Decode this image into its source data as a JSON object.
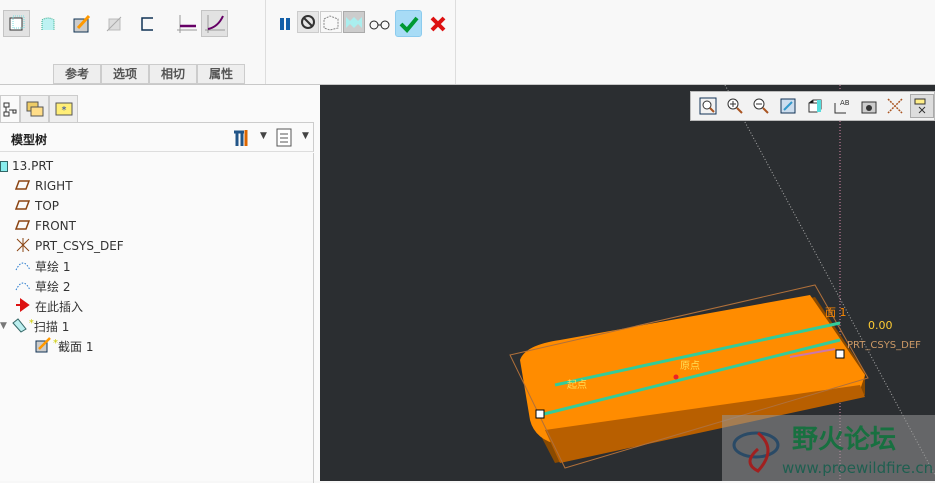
{
  "ribbon": {
    "left_icons": [
      "extrude-solid-icon",
      "surface-icon",
      "sketch-edit-icon",
      "thin-icon",
      "profile-icon",
      "constant-section-icon",
      "variable-section-icon"
    ],
    "tabs": [
      "参考",
      "选项",
      "相切",
      "属性"
    ],
    "right_icons": [
      "pause-icon",
      "no-preview-icon",
      "geometry-preview-icon",
      "attach-preview-icon",
      "glasses-icon",
      "ok-icon",
      "cancel-icon"
    ]
  },
  "panel": {
    "tabs": [
      "model-tree-tab",
      "folder-browser-tab",
      "favorites-tab"
    ],
    "title": "模型树",
    "tree": [
      {
        "label": "13.PRT",
        "icon": "part-icon"
      },
      {
        "label": "RIGHT",
        "icon": "datum-plane-icon"
      },
      {
        "label": "TOP",
        "icon": "datum-plane-icon"
      },
      {
        "label": "FRONT",
        "icon": "datum-plane-icon"
      },
      {
        "label": "PRT_CSYS_DEF",
        "icon": "csys-icon"
      },
      {
        "label": "草绘 1",
        "icon": "sketch-icon"
      },
      {
        "label": "草绘 2",
        "icon": "sketch-icon"
      },
      {
        "label": "在此插入",
        "icon": "insert-here-icon"
      },
      {
        "label": "扫描 1",
        "icon": "sweep-icon",
        "marker": "*"
      },
      {
        "label": "截面 1",
        "icon": "section-icon",
        "marker": "*"
      }
    ]
  },
  "viewport": {
    "toolbar": [
      "refit-icon",
      "zoom-in-icon",
      "zoom-out-icon",
      "repaint-icon",
      "display-style-icon",
      "saved-views-icon",
      "view-manager-icon",
      "datum-display-icon",
      "annotation-display-icon"
    ],
    "labels": {
      "section": "面 1",
      "dim": "0.00",
      "csys": "PRT_CSYS_DEF",
      "origin": "原点",
      "start": "起点"
    },
    "watermark": {
      "title": "野火论坛",
      "url": "www.proewildfire.cn"
    }
  }
}
